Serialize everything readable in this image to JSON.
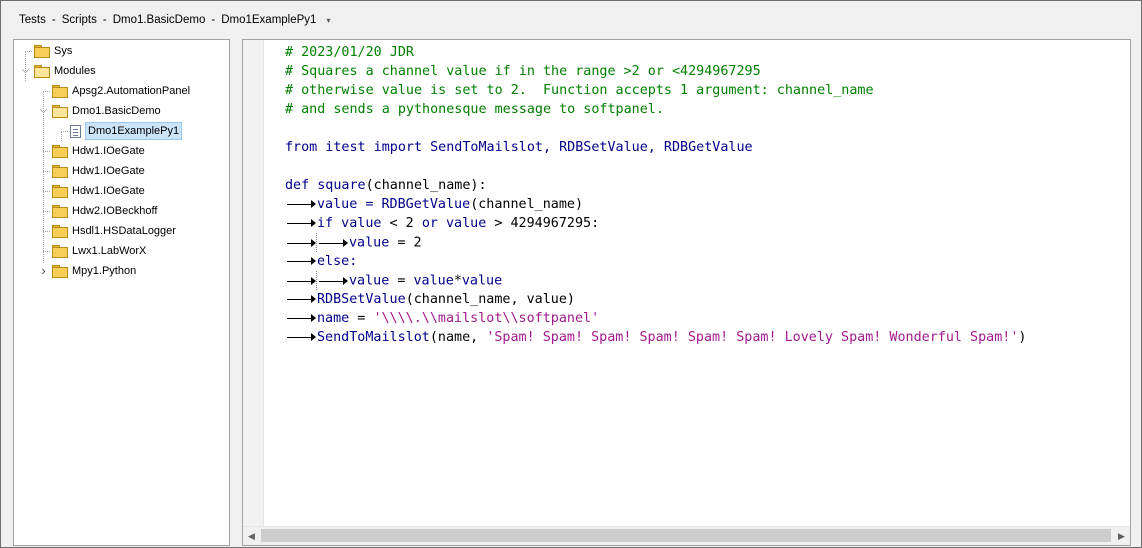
{
  "breadcrumb": {
    "items": [
      "Tests",
      "Scripts",
      "Dmo1.BasicDemo",
      "Dmo1ExamplePy1"
    ],
    "separator": "-",
    "dropdown": "▾"
  },
  "tree": {
    "nodes": [
      {
        "label": "Sys",
        "type": "folder",
        "level": 0,
        "expander": ""
      },
      {
        "label": "Modules",
        "type": "folder-open",
        "level": 0,
        "expander": "v"
      },
      {
        "label": "Apsg2.AutomationPanel",
        "type": "folder",
        "level": 1,
        "expander": ""
      },
      {
        "label": "Dmo1.BasicDemo",
        "type": "folder-open",
        "level": 1,
        "expander": "v"
      },
      {
        "label": "Dmo1ExamplePy1",
        "type": "document",
        "level": 2,
        "expander": "",
        "selected": true
      },
      {
        "label": "Hdw1.IOeGate",
        "type": "folder",
        "level": 1,
        "expander": ""
      },
      {
        "label": "Hdw1.IOeGate",
        "type": "folder",
        "level": 1,
        "expander": ""
      },
      {
        "label": "Hdw1.IOeGate",
        "type": "folder",
        "level": 1,
        "expander": ""
      },
      {
        "label": "Hdw2.IOBeckhoff",
        "type": "folder",
        "level": 1,
        "expander": ""
      },
      {
        "label": "Hsdl1.HSDataLogger",
        "type": "folder",
        "level": 1,
        "expander": ""
      },
      {
        "label": "Lwx1.LabWorX",
        "type": "folder",
        "level": 1,
        "expander": ""
      },
      {
        "label": "Mpy1.Python",
        "type": "folder",
        "level": 1,
        "expander": ">"
      }
    ]
  },
  "editor": {
    "lines": [
      [
        {
          "t": "c",
          "v": "# 2023/01/20 JDR"
        }
      ],
      [
        {
          "t": "c",
          "v": "# Squares a channel value if in the range >2 or <4294967295"
        }
      ],
      [
        {
          "t": "c",
          "v": "# otherwise value is set to 2.  Function accepts 1 argument: channel_name"
        }
      ],
      [
        {
          "t": "c",
          "v": "# and sends a pythonesque message to softpanel."
        }
      ],
      [],
      [
        {
          "t": "k",
          "v": "from itest import SendToMailslot, RDBSetValue, RDBGetValue"
        }
      ],
      [],
      [
        {
          "t": "k",
          "v": "def square"
        },
        {
          "t": "n",
          "v": "(channel_name):"
        }
      ],
      [
        {
          "t": "tab"
        },
        {
          "t": "k",
          "v": "value = RDBGetValue"
        },
        {
          "t": "n",
          "v": "(channel_name)"
        }
      ],
      [
        {
          "t": "tab"
        },
        {
          "t": "k",
          "v": "if value"
        },
        {
          "t": "n",
          "v": " < 2 "
        },
        {
          "t": "k",
          "v": "or value"
        },
        {
          "t": "n",
          "v": " > 4294967295:"
        }
      ],
      [
        {
          "t": "tab"
        },
        {
          "t": "guide"
        },
        {
          "t": "tab"
        },
        {
          "t": "k",
          "v": "value"
        },
        {
          "t": "n",
          "v": " = 2"
        }
      ],
      [
        {
          "t": "tab"
        },
        {
          "t": "k",
          "v": "else:"
        }
      ],
      [
        {
          "t": "tab"
        },
        {
          "t": "guide"
        },
        {
          "t": "tab"
        },
        {
          "t": "k",
          "v": "value"
        },
        {
          "t": "n",
          "v": " = "
        },
        {
          "t": "k",
          "v": "value"
        },
        {
          "t": "n",
          "v": "*"
        },
        {
          "t": "k",
          "v": "value"
        }
      ],
      [
        {
          "t": "tab"
        },
        {
          "t": "k",
          "v": "RDBSetValue"
        },
        {
          "t": "n",
          "v": "(channel_name, value)"
        }
      ],
      [
        {
          "t": "tab"
        },
        {
          "t": "k",
          "v": "name"
        },
        {
          "t": "n",
          "v": " = "
        },
        {
          "t": "s",
          "v": "'\\\\\\\\.\\\\mailslot\\\\softpanel'"
        }
      ],
      [
        {
          "t": "tab"
        },
        {
          "t": "k",
          "v": "SendToMailslot"
        },
        {
          "t": "n",
          "v": "(name, "
        },
        {
          "t": "s",
          "v": "'Spam! Spam! Spam! Spam! Spam! Spam! Lovely Spam! Wonderful Spam!'"
        },
        {
          "t": "n",
          "v": ")"
        }
      ]
    ]
  },
  "scrollbar": {
    "left_arrow": "◀",
    "right_arrow": "▶"
  },
  "colors": {
    "comment": "#008000",
    "keyword": "#00008b",
    "string": "#a31a8e",
    "selection": "#cce4f7"
  }
}
